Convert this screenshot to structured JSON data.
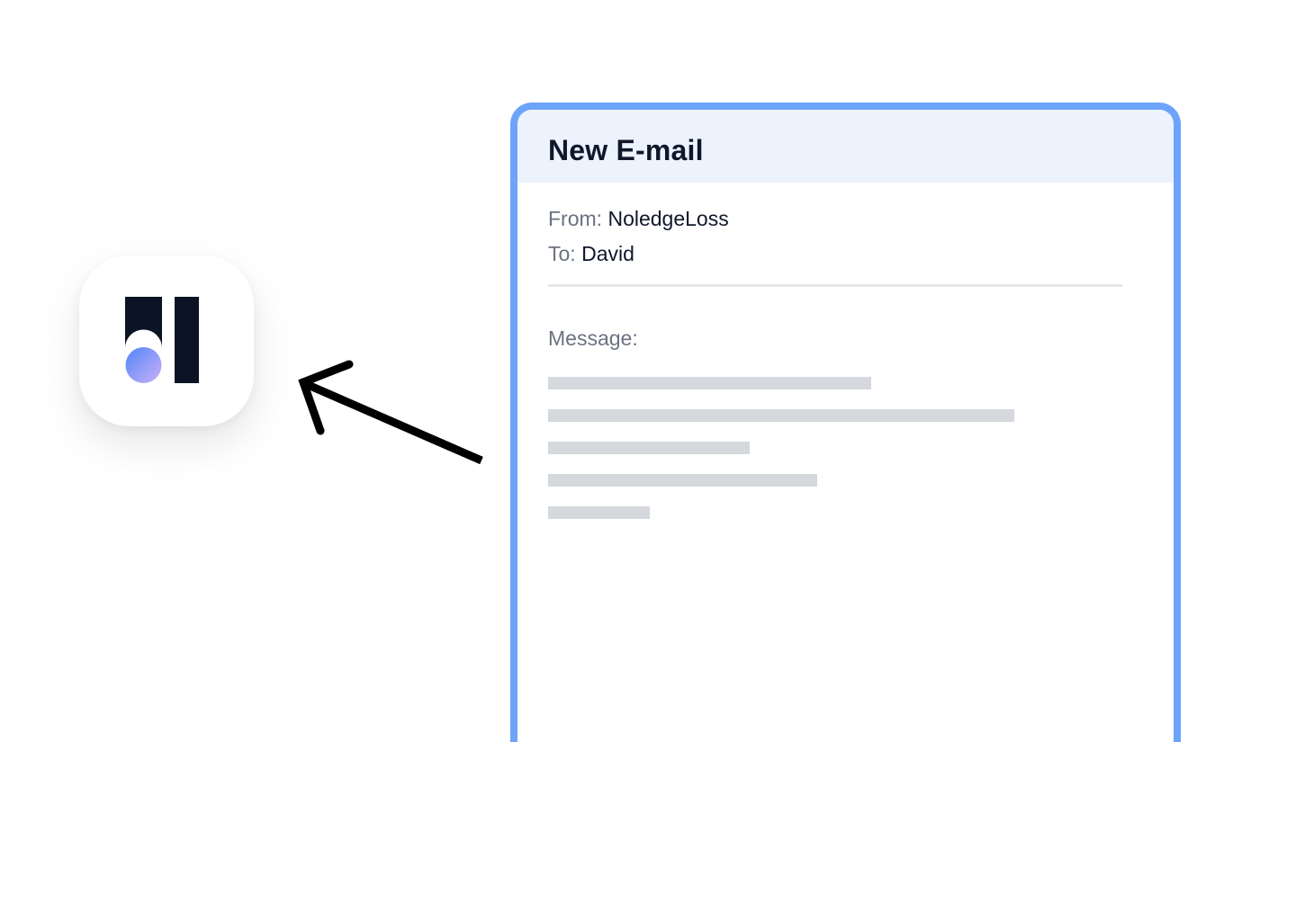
{
  "app": {
    "icon": "noledgeloss-logo-icon",
    "colors": {
      "logo_dark": "#0b1424",
      "logo_gradient_start": "#5b8ef7",
      "logo_gradient_end": "#c4a8f5"
    }
  },
  "arrow": {
    "icon": "arrow-pointing-left-icon",
    "color": "#000000"
  },
  "email": {
    "title": "New E-mail",
    "from_label": "From:",
    "from_value": "NoledgeLoss",
    "to_label": "To:",
    "to_value": "David",
    "message_label": "Message:",
    "message_placeholder_lines": 5,
    "colors": {
      "border": "#6ea3fa",
      "header_bg": "#edf3fd",
      "placeholder": "#d5d8dc"
    }
  }
}
